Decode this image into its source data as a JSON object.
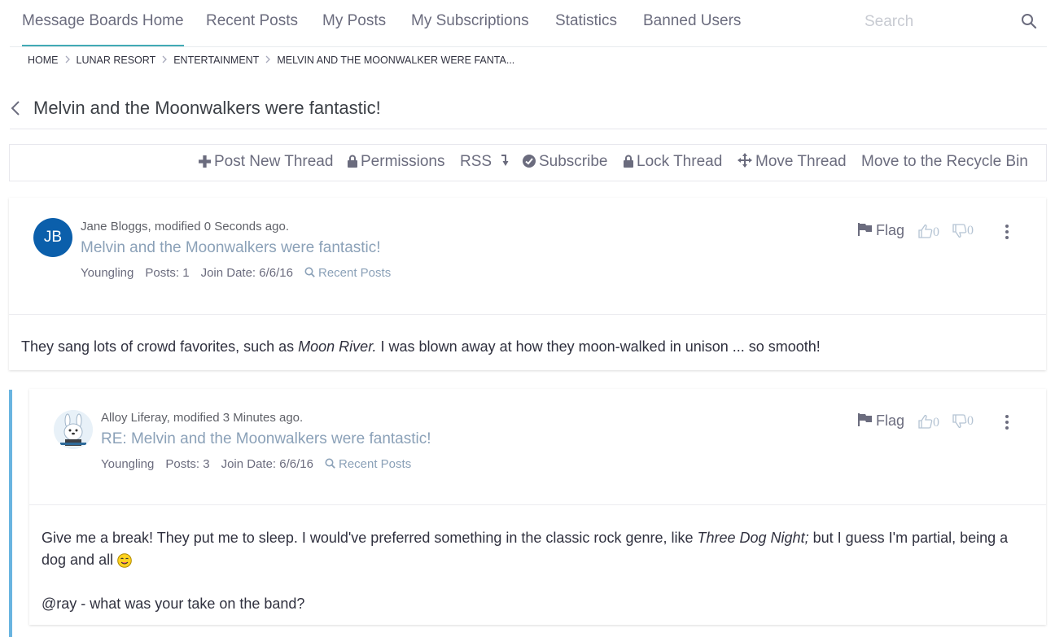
{
  "nav": {
    "items": [
      "Message Boards Home",
      "Recent Posts",
      "My Posts",
      "My Subscriptions",
      "Statistics",
      "Banned Users"
    ],
    "search_placeholder": "Search"
  },
  "breadcrumb": [
    "HOME",
    "LUNAR RESORT",
    "ENTERTAINMENT",
    "MELVIN AND THE MOONWALKER WERE FANTA..."
  ],
  "thread": {
    "title": "Melvin and the Moonwalkers were fantastic!"
  },
  "toolbar": {
    "post_new_thread": "Post New Thread",
    "permissions": "Permissions",
    "rss": "RSS",
    "subscribe": "Subscribe",
    "lock_thread": "Lock Thread",
    "move_thread": "Move Thread",
    "recycle": "Move to the Recycle Bin"
  },
  "posts": [
    {
      "avatar_initials": "JB",
      "author_line": "Jane Bloggs, modified 0 Seconds ago.",
      "title": "Melvin and the Moonwalkers were fantastic!",
      "rank": "Youngling",
      "posts": "Posts: 1",
      "join_date": "Join Date: 6/6/16",
      "recent_posts": "Recent Posts",
      "flag": "Flag",
      "thumbs_up": "0",
      "thumbs_down": "0",
      "body_before": "They sang lots of crowd favorites, such as ",
      "body_italic": "Moon River.",
      "body_after": " I was blown away at how they moon-walked in unison ... so smooth!"
    },
    {
      "author_line": "Alloy Liferay, modified 3 Minutes ago.",
      "title": "RE: Melvin and the Moonwalkers were fantastic!",
      "rank": "Youngling",
      "posts": "Posts: 3",
      "join_date": "Join Date: 6/6/16",
      "recent_posts": "Recent Posts",
      "flag": "Flag",
      "thumbs_up": "0",
      "thumbs_down": "0",
      "body_before": "Give me a break! They put me to sleep. I would've preferred something in the classic rock genre, like ",
      "body_italic": "Three Dog Night;",
      "body_after": " but I guess I'm partial, being a dog and all",
      "body_line2": "@ray - what was your take on the band?"
    }
  ],
  "colors": {
    "accent": "#41aab5",
    "avatar_blue": "#0b5fab",
    "thread_line": "#69b4e0",
    "link": "#8ba1b8"
  }
}
